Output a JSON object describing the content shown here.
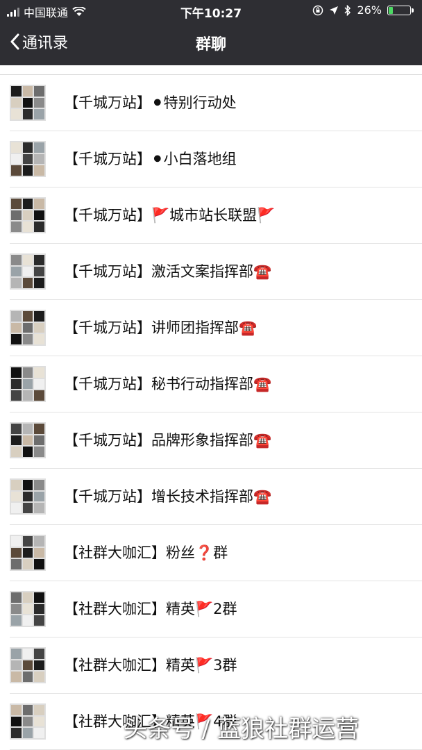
{
  "status_bar": {
    "carrier": "中国联通",
    "time": "下午10:27",
    "battery": "26%",
    "battery_level": 0.26
  },
  "nav": {
    "back_label": "通讯录",
    "title": "群聊"
  },
  "groups": [
    {
      "name": "【千城万站】⚫特别行动处"
    },
    {
      "name": "【千城万站】⚫小白落地组"
    },
    {
      "name": "【千城万站】🚩城市站长联盟🚩"
    },
    {
      "name": "【千城万站】激活文案指挥部☎️"
    },
    {
      "name": "【千城万站】讲师团指挥部☎️"
    },
    {
      "name": "【千城万站】秘书行动指挥部☎️"
    },
    {
      "name": "【千城万站】品牌形象指挥部☎️"
    },
    {
      "name": "【千城万站】增长技术指挥部☎️"
    },
    {
      "name": "【社群大咖汇】粉丝❓群"
    },
    {
      "name": "【社群大咖汇】精英🚩2群"
    },
    {
      "name": "【社群大咖汇】精英🚩3群"
    },
    {
      "name": "【社群大咖汇】精英🚩4群"
    }
  ],
  "watermark": "头条号 / 蓝狼社群运营"
}
